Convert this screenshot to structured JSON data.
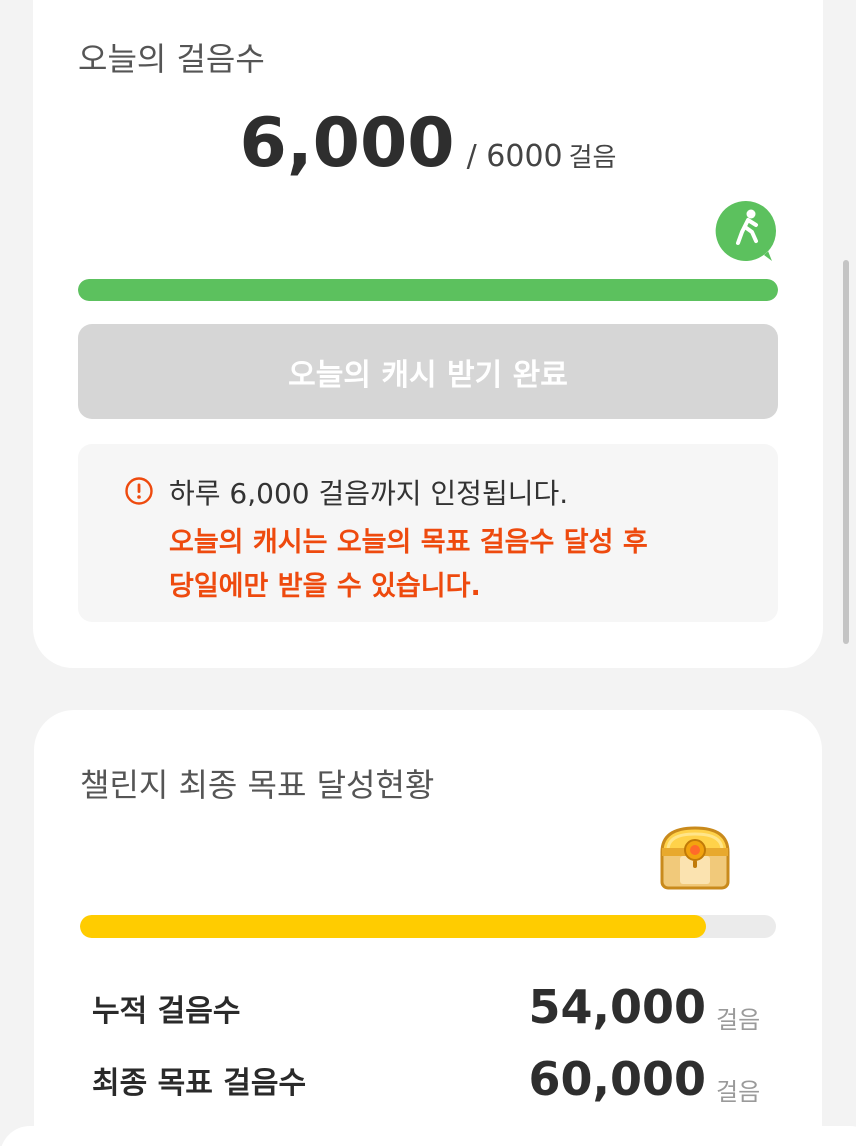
{
  "today": {
    "title": "오늘의 걸음수",
    "steps": "6,000",
    "goal": "/ 6000",
    "unit": "걸음",
    "progress_fraction": 1.0,
    "claim_button_label": "오늘의 캐시 받기 완료",
    "notice": {
      "line1": "하루 6,000 걸음까지 인정됩니다.",
      "line2": "오늘의 캐시는 오늘의 목표 걸음수 달성 후",
      "line3": "당일에만 받을 수 있습니다."
    }
  },
  "challenge": {
    "title": "챌린지 최종 목표 달성현황",
    "progress_fraction": 0.9,
    "cumulative": {
      "label": "누적 걸음수",
      "value": "54,000",
      "unit": "걸음"
    },
    "final_goal": {
      "label": "최종 목표 걸음수",
      "value": "60,000",
      "unit": "걸음"
    }
  },
  "colors": {
    "green": "#5cc15e",
    "yellow": "#ffcc00",
    "warning": "#ee4a0e",
    "button_disabled": "#d6d6d6"
  },
  "icons": {
    "walker_badge": "walking-person-icon",
    "notice": "exclamation-circle-icon",
    "chest": "treasure-chest-icon"
  }
}
